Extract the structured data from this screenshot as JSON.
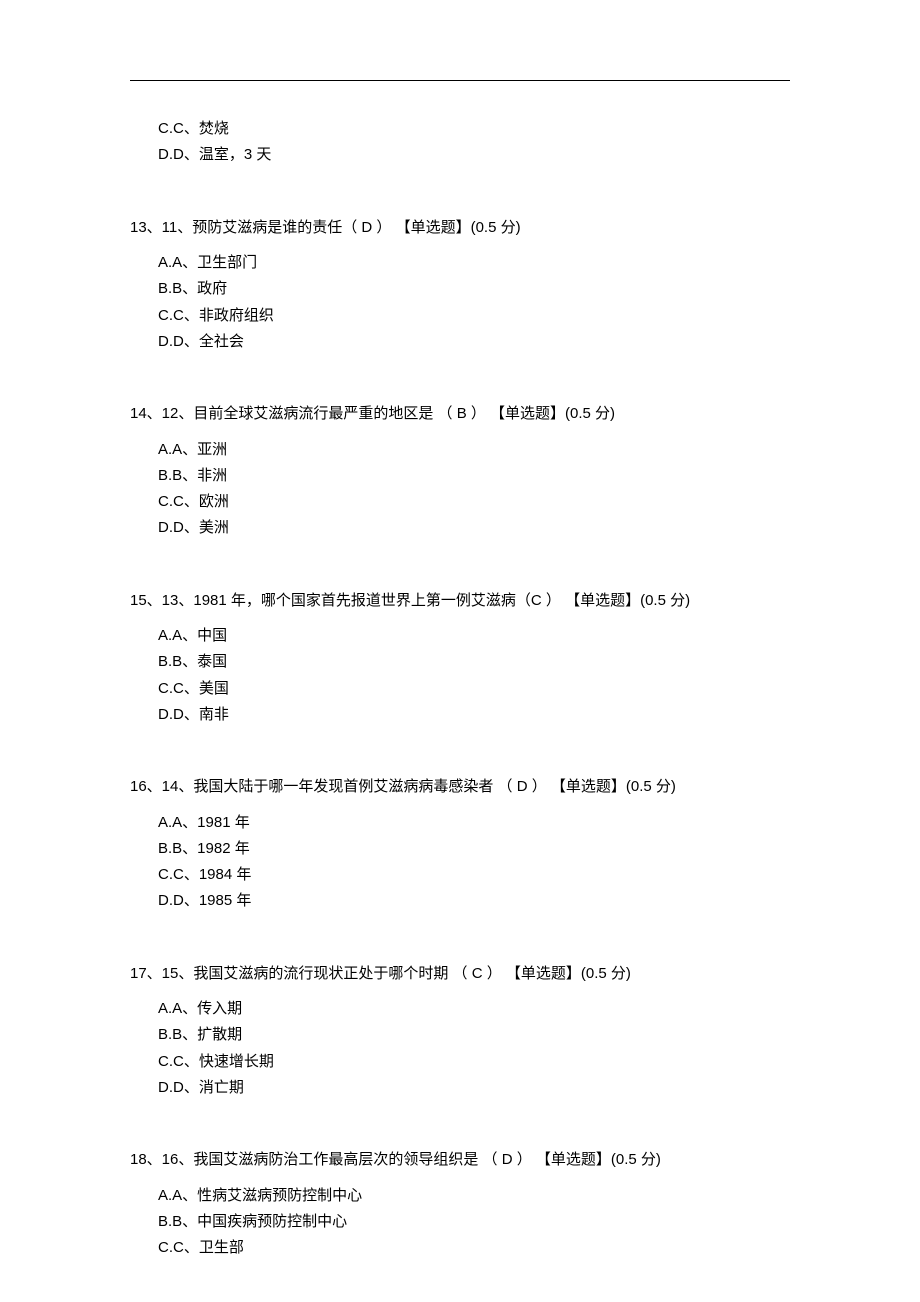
{
  "orphan": {
    "optC": "C.C、焚烧",
    "optD": "D.D、温室，3 天"
  },
  "q13": {
    "stem": "13、11、预防艾滋病是谁的责任（ D ） 【单选题】(0.5 分)",
    "optA": "A.A、卫生部门",
    "optB": "B.B、政府",
    "optC": "C.C、非政府组织",
    "optD": "D.D、全社会"
  },
  "q14": {
    "stem": "14、12、目前全球艾滋病流行最严重的地区是 （ B ）   【单选题】(0.5 分)",
    "optA": "A.A、亚洲",
    "optB": "B.B、非洲",
    "optC": "C.C、欧洲",
    "optD": "D.D、美洲"
  },
  "q15": {
    "stem": "15、13、1981 年，哪个国家首先报道世界上第一例艾滋病（C ） 【单选题】(0.5 分)",
    "optA": "A.A、中国",
    "optB": "B.B、泰国",
    "optC": "C.C、美国",
    "optD": "D.D、南非"
  },
  "q16": {
    "stem": "16、14、我国大陆于哪一年发现首例艾滋病病毒感染者 （ D ）   【单选题】(0.5 分)",
    "optA": "A.A、1981 年",
    "optB": "B.B、1982 年",
    "optC": "C.C、1984 年",
    "optD": "D.D、1985 年"
  },
  "q17": {
    "stem": "17、15、我国艾滋病的流行现状正处于哪个时期 （ C ）   【单选题】(0.5 分)",
    "optA": "A.A、传入期",
    "optB": "B.B、扩散期",
    "optC": "C.C、快速增长期",
    "optD": "D.D、消亡期"
  },
  "q18": {
    "stem": "18、16、我国艾滋病防治工作最高层次的领导组织是 （ D ）   【单选题】(0.5 分)",
    "optA": "A.A、性病艾滋病预防控制中心",
    "optB": "B.B、中国疾病预防控制中心",
    "optC": "C.C、卫生部"
  }
}
